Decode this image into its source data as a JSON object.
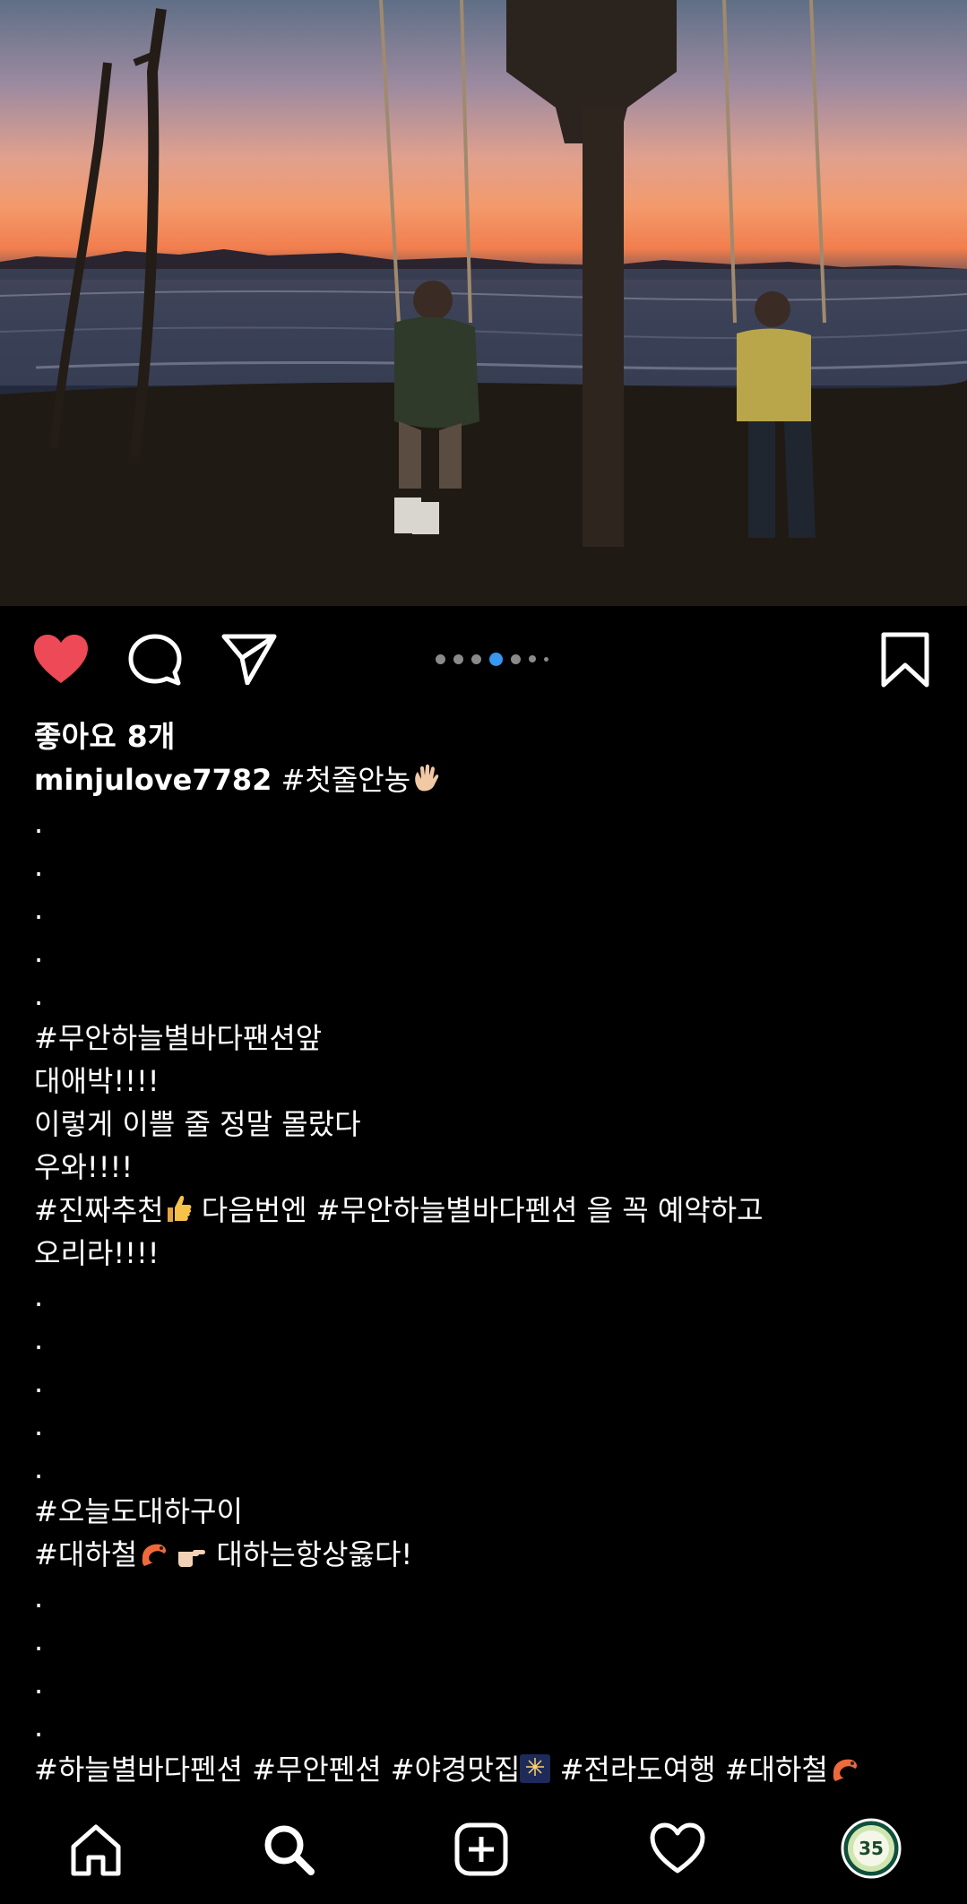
{
  "post": {
    "image_description_icon": "photo-sunset-swings",
    "carousel": {
      "total": 7,
      "active_index": 3
    },
    "liked": true,
    "likes_label": "좋아요 8개",
    "username": "minjulove7782",
    "caption_first": "#첫줄안농",
    "lines": {
      "dot": ".",
      "l1": "#무안하늘별바다팬션앞",
      "l2": "대애박!!!!",
      "l3": "이렇게 이쁠 줄 정말 몰랐다",
      "l4": "우와!!!!",
      "l5a": "#진짜추천",
      "l5b": " 다음번엔 #무안하늘별바다펜션 을 꼭 예약하고",
      "l6": "오리라!!!!",
      "l7": "#오늘도대하구이",
      "l8a": "#대하철",
      "l8b": " 대하는항상옳다!",
      "l9a": "#하늘별바다펜션 #무안펜션 #야경맛집",
      "l9b": " #전라도여행 #대하철"
    }
  },
  "colors": {
    "like_red": "#ed4956",
    "active_dot": "#3897f0",
    "inactive_dot": "#8a8a8a"
  },
  "nav": {
    "items": [
      "home-icon",
      "search-icon",
      "add-icon",
      "heart-icon",
      "profile-avatar"
    ],
    "avatar_text": "35"
  }
}
